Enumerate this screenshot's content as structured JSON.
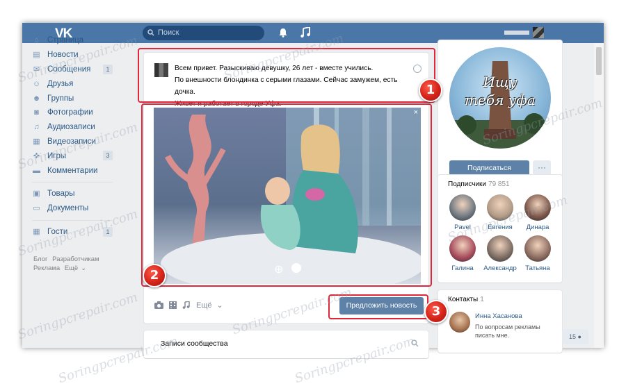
{
  "topbar": {
    "logo": "VK",
    "search_placeholder": "Поиск",
    "icons": [
      "search-icon",
      "bell-icon",
      "music-icon"
    ]
  },
  "sidebar": {
    "items": [
      {
        "label": "Страница",
        "icon": "home-icon",
        "badge": ""
      },
      {
        "label": "Новости",
        "icon": "news-icon",
        "badge": ""
      },
      {
        "label": "Сообщения",
        "icon": "messages-icon",
        "badge": "1"
      },
      {
        "label": "Друзья",
        "icon": "friends-icon",
        "badge": ""
      },
      {
        "label": "Группы",
        "icon": "groups-icon",
        "badge": ""
      },
      {
        "label": "Фотографии",
        "icon": "camera-icon",
        "badge": ""
      },
      {
        "label": "Аудиозаписи",
        "icon": "music-icon",
        "badge": ""
      },
      {
        "label": "Видеозаписи",
        "icon": "video-icon",
        "badge": ""
      },
      {
        "label": "Игры",
        "icon": "gamepad-icon",
        "badge": "3"
      },
      {
        "label": "Комментарии",
        "icon": "comment-icon",
        "badge": ""
      },
      {
        "label": "Товары",
        "icon": "bag-icon",
        "badge": ""
      },
      {
        "label": "Документы",
        "icon": "document-icon",
        "badge": ""
      },
      {
        "label": "Гости",
        "icon": "apps-icon",
        "badge": "1"
      }
    ],
    "footer_links": [
      "Блог",
      "Разработчикам",
      "Реклама",
      "Ещё"
    ]
  },
  "post": {
    "text_lines": [
      "Всем привет. Разыскиваю девушку, 26 лет - вместе учились.",
      "По внешности блондинка с серыми глазами. Сейчас замужем, есть дочка.",
      "Живет и работает в городе Уфа."
    ],
    "close_label": "×",
    "attach_more": "Ещё",
    "suggest_button": "Предложить новость"
  },
  "records": {
    "title": "Записи сообщества"
  },
  "group": {
    "avatar_line1": "Ищу",
    "avatar_line2": "тебя уфа",
    "subscribe_button": "Подписаться",
    "more_button": "···"
  },
  "subscribers": {
    "title": "Подписчики",
    "count": "79 851",
    "people": [
      {
        "name": "Pavel",
        "color": "#6d7780"
      },
      {
        "name": "Евгения",
        "color": "#b09a86"
      },
      {
        "name": "Динара",
        "color": "#7a5548"
      },
      {
        "name": "Галина",
        "color": "#a5495a"
      },
      {
        "name": "Александр",
        "color": "#7b6b62"
      },
      {
        "name": "Татьяна",
        "color": "#8b6a5e"
      }
    ]
  },
  "contacts": {
    "title": "Контакты",
    "count": "1",
    "name": "Инна Хасанова",
    "desc_line1": "По вопросам рекламы",
    "desc_line2": "писать мне.",
    "guest_count": "15"
  },
  "annotations": {
    "marker1": "1",
    "marker2": "2",
    "marker3": "3",
    "watermark": "Soringpcrepair.com"
  }
}
